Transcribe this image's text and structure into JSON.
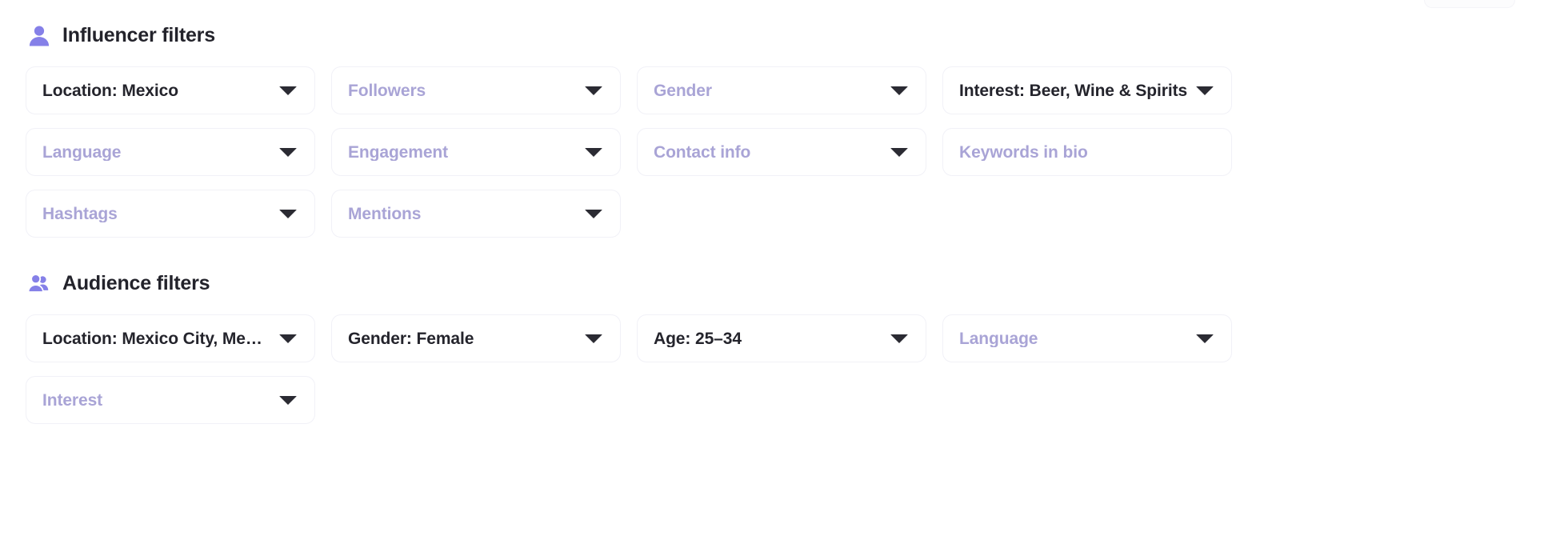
{
  "theme": {
    "accent": "#7f7aea",
    "text_dark": "#24242c",
    "placeholder": "#a9a4d6",
    "border": "#f1f1f7",
    "background": "#ffffff"
  },
  "sections": [
    {
      "id": "influencer",
      "title": "Influencer filters",
      "icon": "person-icon",
      "fields": [
        {
          "name": "location",
          "label": "Location: Mexico",
          "state": "selected",
          "control": "dropdown"
        },
        {
          "name": "followers",
          "label": "Followers",
          "state": "placeholder",
          "control": "dropdown"
        },
        {
          "name": "gender",
          "label": "Gender",
          "state": "placeholder",
          "control": "dropdown"
        },
        {
          "name": "interest",
          "label": "Interest: Beer, Wine & Spirits",
          "state": "selected",
          "control": "dropdown"
        },
        {
          "name": "language",
          "label": "Language",
          "state": "placeholder",
          "control": "dropdown"
        },
        {
          "name": "engagement",
          "label": "Engagement",
          "state": "placeholder",
          "control": "dropdown"
        },
        {
          "name": "contact-info",
          "label": "Contact info",
          "state": "placeholder",
          "control": "dropdown"
        },
        {
          "name": "keywords-in-bio",
          "label": "Keywords in bio",
          "state": "placeholder",
          "control": "text"
        },
        {
          "name": "hashtags",
          "label": "Hashtags",
          "state": "placeholder",
          "control": "dropdown"
        },
        {
          "name": "mentions",
          "label": "Mentions",
          "state": "placeholder",
          "control": "dropdown"
        },
        {
          "name": "spacer-1",
          "label": "",
          "state": "empty",
          "control": "none"
        },
        {
          "name": "spacer-2",
          "label": "",
          "state": "empty",
          "control": "none"
        }
      ]
    },
    {
      "id": "audience",
      "title": "Audience filters",
      "icon": "people-icon",
      "fields": [
        {
          "name": "location",
          "label": "Location: Mexico City, Mexico",
          "state": "selected",
          "control": "dropdown"
        },
        {
          "name": "gender",
          "label": "Gender: Female",
          "state": "selected",
          "control": "dropdown"
        },
        {
          "name": "age",
          "label": "Age: 25–34",
          "state": "selected",
          "control": "dropdown"
        },
        {
          "name": "language",
          "label": "Language",
          "state": "placeholder",
          "control": "dropdown"
        },
        {
          "name": "interest",
          "label": "Interest",
          "state": "placeholder",
          "control": "dropdown"
        },
        {
          "name": "spacer-1",
          "label": "",
          "state": "empty",
          "control": "none"
        },
        {
          "name": "spacer-2",
          "label": "",
          "state": "empty",
          "control": "none"
        },
        {
          "name": "spacer-3",
          "label": "",
          "state": "empty",
          "control": "none"
        }
      ]
    }
  ]
}
